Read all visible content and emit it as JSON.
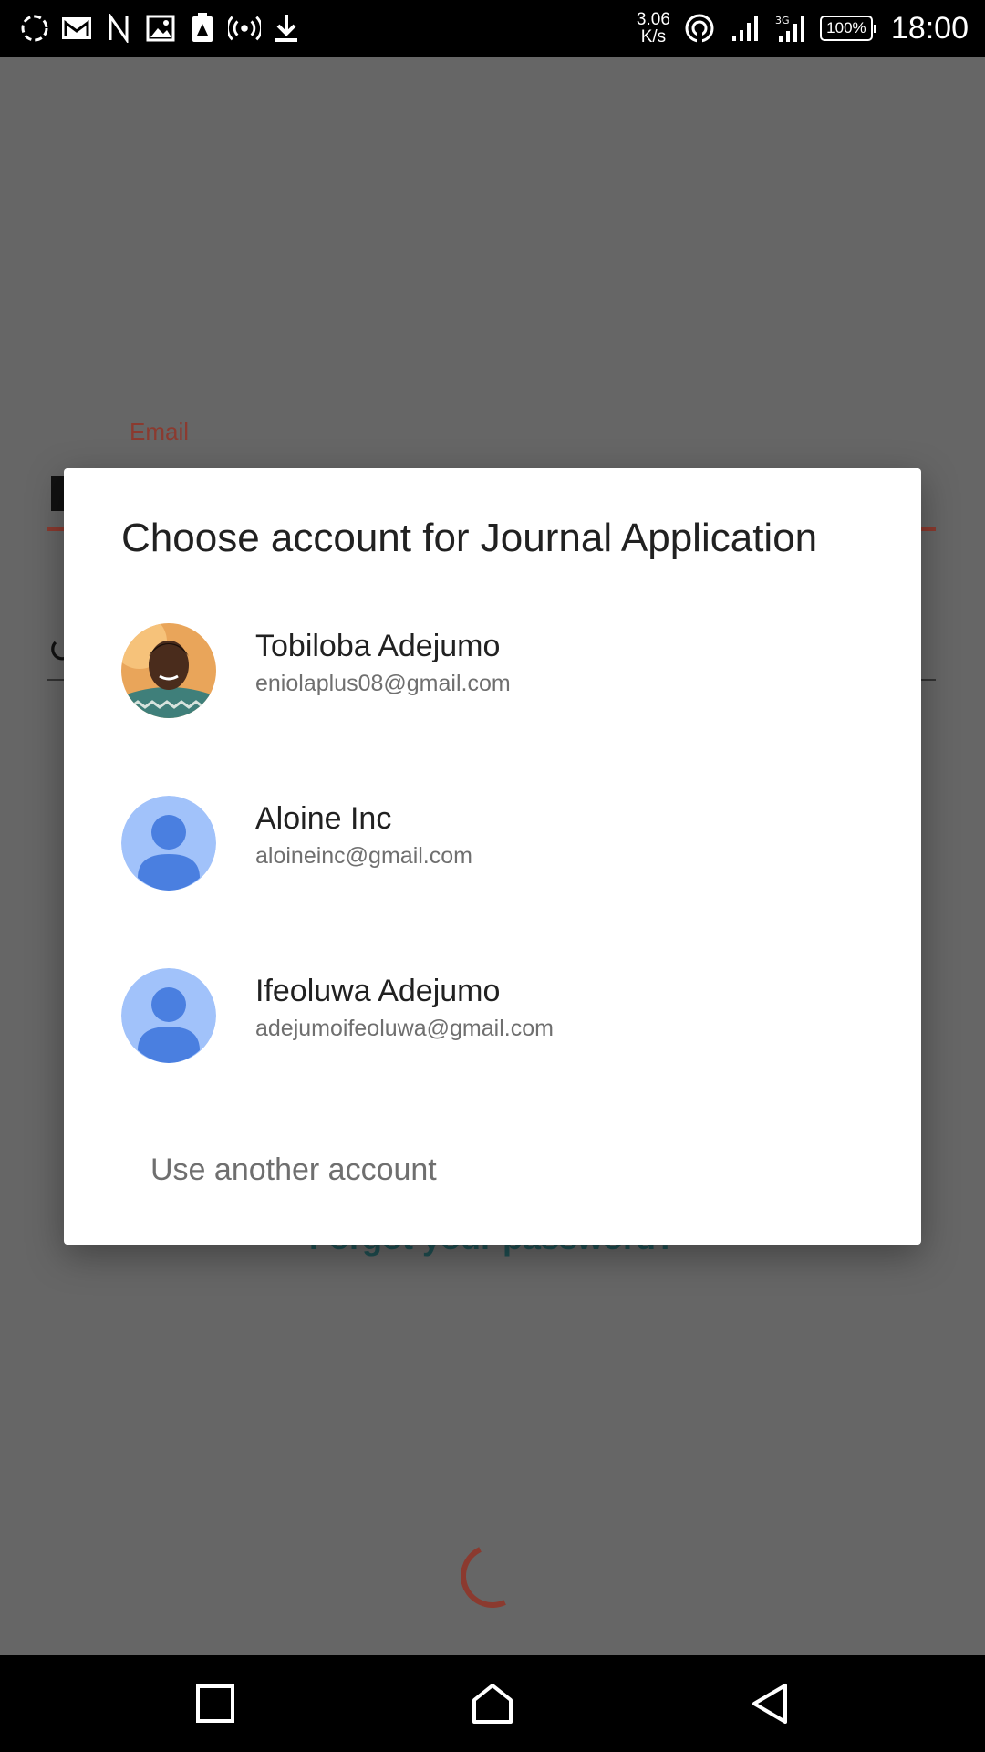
{
  "status_bar": {
    "icons": [
      "sync-icon",
      "gmail-icon",
      "n-app-icon",
      "gallery-icon",
      "warning-icon",
      "hotspot-icon",
      "download-icon"
    ],
    "speed_value": "3.06",
    "speed_unit": "K/s",
    "right_icons": [
      "wifi-icon",
      "signal-icon",
      "signal-3g-icon"
    ],
    "battery": "100%",
    "time": "18:00"
  },
  "background_form": {
    "email_label": "Email",
    "forgot_text": "Forgot your password?"
  },
  "dialog": {
    "title": "Choose account for Journal Application",
    "accounts": [
      {
        "name": "Tobiloba Adejumo",
        "email": "eniolaplus08@gmail.com",
        "avatar": "photo-avatar"
      },
      {
        "name": "Aloine Inc",
        "email": "aloineinc@gmail.com",
        "avatar": "default-avatar"
      },
      {
        "name": "Ifeoluwa Adejumo",
        "email": "adejumoifeoluwa@gmail.com",
        "avatar": "default-avatar"
      }
    ],
    "use_another": "Use another account"
  },
  "nav_bar": {
    "buttons": [
      "recents-square-icon",
      "home-icon",
      "back-triangle-icon"
    ]
  },
  "colors": {
    "scrim": "#666666",
    "accent": "#8b3a2f",
    "avatar_bg": "#a1c2fa",
    "avatar_fg": "#4a7fe0"
  }
}
